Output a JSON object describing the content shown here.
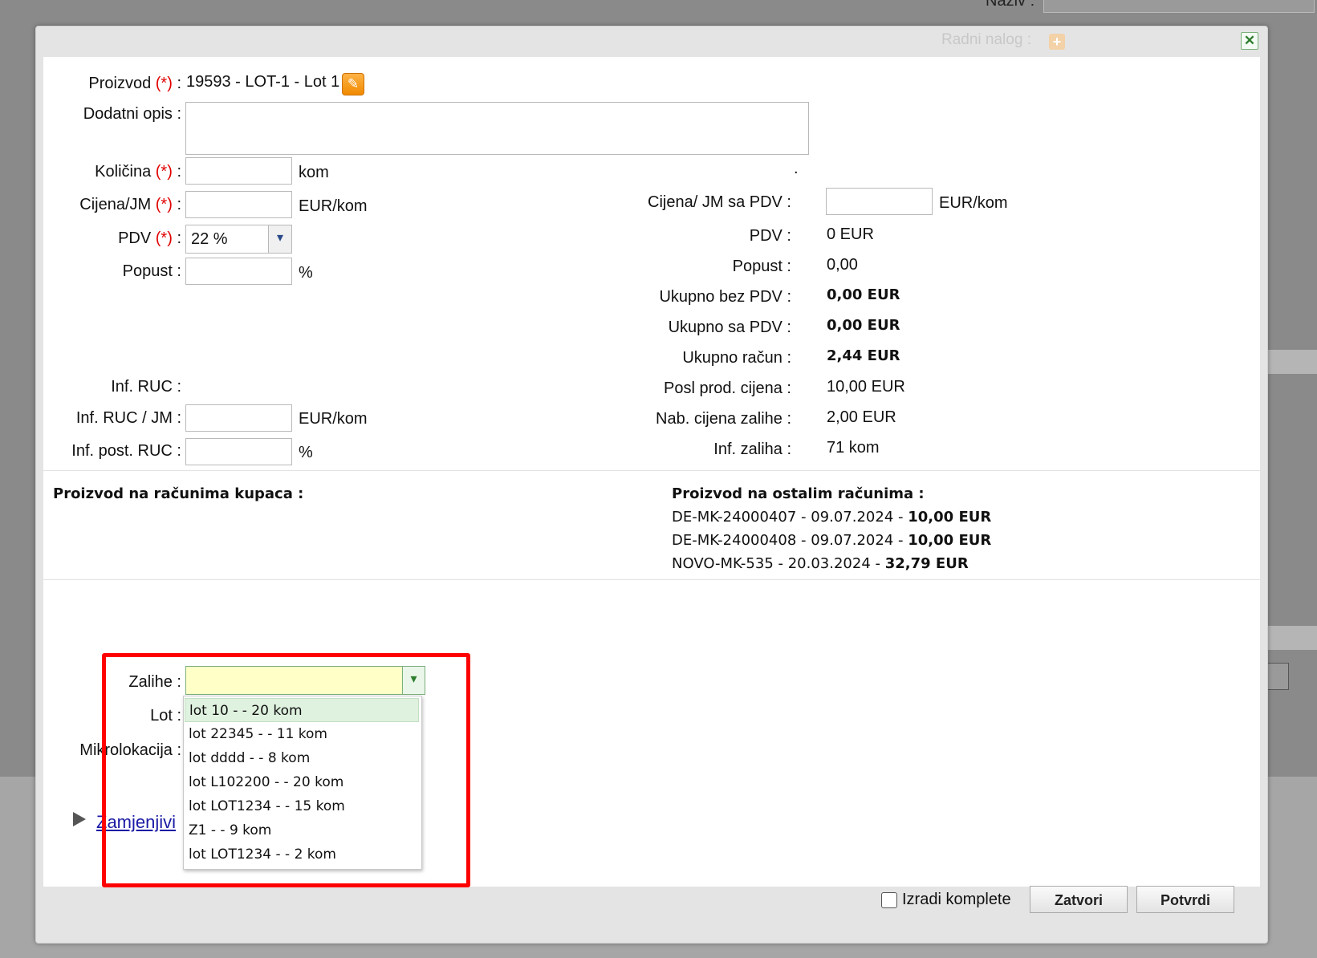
{
  "background": {
    "top_label": "Naziv :"
  },
  "dialog": {
    "title_label": "Radni nalog :",
    "close_glyph": "✕"
  },
  "form": {
    "proizvod": {
      "label": "Proizvod",
      "required": "(*)",
      "colon": ":",
      "value": "19593 - LOT-1 - Lot 1"
    },
    "dodatni_opis": {
      "label": "Dodatni opis :"
    },
    "kolicina": {
      "label": "Količina",
      "required": "(*)",
      "colon": ":",
      "unit": "kom",
      "dot": "."
    },
    "cijena_jm": {
      "label": "Cijena/JM",
      "required": "(*)",
      "colon": ":",
      "unit": "EUR/kom"
    },
    "pdv": {
      "label": "PDV",
      "required": "(*)",
      "colon": ":",
      "value": "22 %"
    },
    "popust": {
      "label": "Popust :",
      "unit": "%"
    },
    "inf_ruc": {
      "label": "Inf. RUC :"
    },
    "inf_ruc_jm": {
      "label": "Inf. RUC / JM :",
      "unit": "EUR/kom"
    },
    "inf_post_ruc": {
      "label": "Inf. post. RUC :",
      "unit": "%"
    }
  },
  "summary": {
    "cijena_jm_pdv": {
      "label": "Cijena/ JM sa PDV :",
      "unit": "EUR/kom"
    },
    "pdv": {
      "label": "PDV :",
      "value": "0 EUR"
    },
    "popust": {
      "label": "Popust :",
      "value": "0,00"
    },
    "ukupno_bez_pdv": {
      "label": "Ukupno bez PDV :",
      "value": "0,00 EUR"
    },
    "ukupno_sa_pdv": {
      "label": "Ukupno sa PDV :",
      "value": "0,00 EUR"
    },
    "ukupno_racun": {
      "label": "Ukupno račun :",
      "value": "2,44 EUR"
    },
    "posl_prod_cijena": {
      "label": "Posl prod. cijena :",
      "value": "10,00 EUR"
    },
    "nab_cijena_zalihe": {
      "label": "Nab. cijena zalihe :",
      "value": "2,00 EUR"
    },
    "inf_zaliha": {
      "label": "Inf. zaliha :",
      "value": "71 kom"
    }
  },
  "invoices": {
    "kupci_title": "Proizvod na računima kupaca :",
    "ostali_title": "Proizvod na ostalim računima :",
    "ostali": [
      {
        "doc": "DE-MK-24000407 - 09.07.2024 -",
        "amount": "10,00 EUR"
      },
      {
        "doc": "DE-MK-24000408 - 09.07.2024 -",
        "amount": "10,00 EUR"
      },
      {
        "doc": "NOVO-MK-535 - 20.03.2024 -",
        "amount": "32,79 EUR"
      }
    ]
  },
  "stock": {
    "zalihe_label": "Zalihe :",
    "lot_label": "Lot :",
    "mikrolokacija_label": "Mikrolokacija :",
    "zamjenjivi_link": "Zamjenjivi",
    "dropdown_items": [
      "lot 10 - - 20 kom",
      "lot 22345 - - 11 kom",
      "lot dddd - - 8 kom",
      "lot L102200 - - 20 kom",
      "lot LOT1234 - - 15 kom",
      "Z1 - - 9 kom",
      "lot LOT1234 - - 2 kom"
    ]
  },
  "footer": {
    "izradi_komplete_label": "Izradi komplete",
    "zatvori_label": "Zatvori",
    "potvrdi_label": "Potvrdi"
  },
  "colors": {
    "required": "#e00000",
    "highlight_frame": "#ff0000",
    "combo_bg": "#ffffc8",
    "selected_item_bg": "#dff1df"
  }
}
